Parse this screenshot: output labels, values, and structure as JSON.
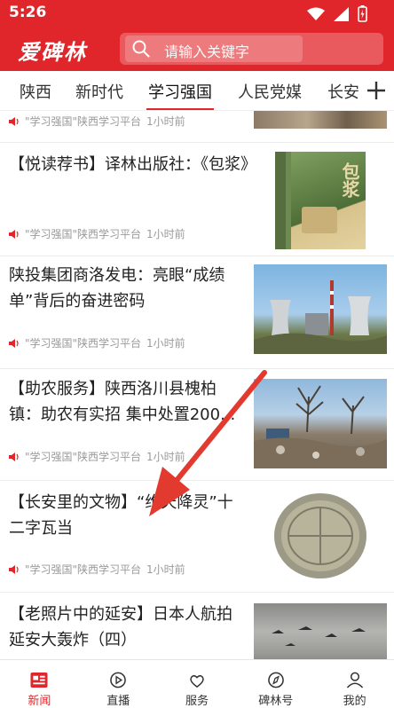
{
  "status": {
    "time": "5:26"
  },
  "app": {
    "logo": "爱碑林",
    "search_placeholder": "请输入关键字",
    "accent": "#e0262a"
  },
  "tabs": [
    {
      "label": "陕西"
    },
    {
      "label": "新时代"
    },
    {
      "label": "学习强国",
      "active": true
    },
    {
      "label": "人民党媒"
    },
    {
      "label": "长安"
    }
  ],
  "feed": [
    {
      "title": "",
      "source": "\"学习强国\"陕西学习平台",
      "time": "1小时前"
    },
    {
      "title": "【悦读荐书】译林出版社：《包浆》",
      "source": "\"学习强国\"陕西学习平台",
      "time": "1小时前"
    },
    {
      "title": "陕投集团商洛发电：亮眼“成绩单”背后的奋进密码",
      "source": "\"学习强国\"陕西学习平台",
      "time": "1小时前"
    },
    {
      "title": "【助农服务】陕西洛川县槐柏镇：助农有实招 集中处置200...",
      "source": "\"学习强国\"陕西学习平台",
      "time": "1小时前"
    },
    {
      "title": "【长安里的文物】“维天降灵”十二字瓦当",
      "source": "\"学习强国\"陕西学习平台",
      "time": "1小时前"
    },
    {
      "title": "【老照片中的延安】日本人航拍延安大轰炸（四）",
      "source": "",
      "time": ""
    }
  ],
  "book_cover": {
    "title": "包浆"
  },
  "bottom_nav": [
    {
      "label": "新闻",
      "icon": "news-icon",
      "active": true
    },
    {
      "label": "直播",
      "icon": "play-icon"
    },
    {
      "label": "服务",
      "icon": "service-icon"
    },
    {
      "label": "碑林号",
      "icon": "compass-icon"
    },
    {
      "label": "我的",
      "icon": "user-icon"
    }
  ]
}
